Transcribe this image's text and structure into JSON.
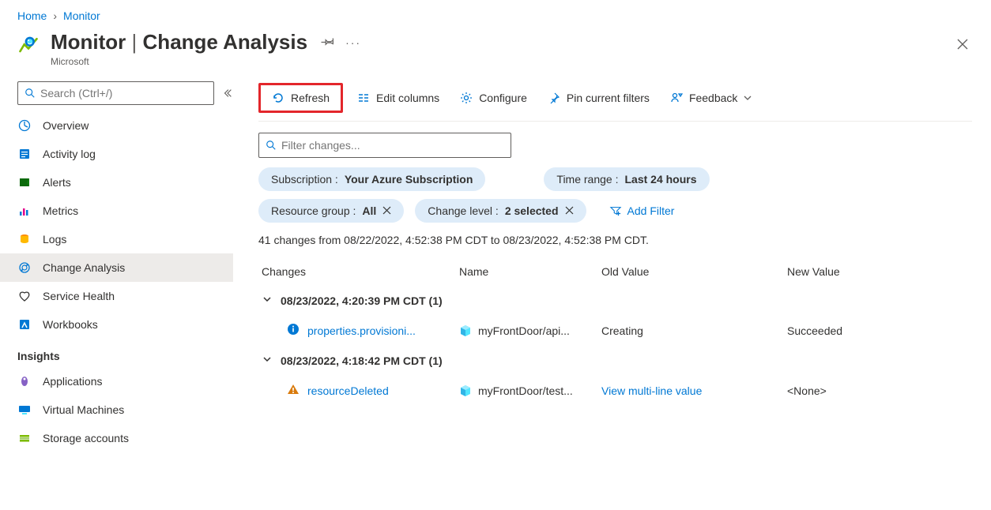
{
  "breadcrumb": {
    "home": "Home",
    "current": "Monitor"
  },
  "header": {
    "title_bold": "Monitor",
    "title_rest": "Change Analysis",
    "subtitle": "Microsoft"
  },
  "search": {
    "placeholder": "Search (Ctrl+/)"
  },
  "nav": {
    "items": [
      {
        "label": "Overview"
      },
      {
        "label": "Activity log"
      },
      {
        "label": "Alerts"
      },
      {
        "label": "Metrics"
      },
      {
        "label": "Logs"
      },
      {
        "label": "Change Analysis"
      },
      {
        "label": "Service Health"
      },
      {
        "label": "Workbooks"
      }
    ],
    "section": "Insights",
    "insights": [
      {
        "label": "Applications"
      },
      {
        "label": "Virtual Machines"
      },
      {
        "label": "Storage accounts"
      }
    ]
  },
  "toolbar": {
    "refresh": "Refresh",
    "edit_columns": "Edit columns",
    "configure": "Configure",
    "pin": "Pin current filters",
    "feedback": "Feedback"
  },
  "filter_input": {
    "placeholder": "Filter changes..."
  },
  "pills": {
    "subscription_label": "Subscription :",
    "subscription_value": "Your Azure Subscription",
    "time_label": "Time range :",
    "time_value": "Last 24 hours",
    "rg_label": "Resource group :",
    "rg_value": "All",
    "level_label": "Change level :",
    "level_value": "2 selected",
    "add_filter": "Add Filter"
  },
  "summary": "41 changes from 08/22/2022, 4:52:38 PM CDT to 08/23/2022, 4:52:38 PM CDT.",
  "columns": {
    "c1": "Changes",
    "c2": "Name",
    "c3": "Old Value",
    "c4": "New Value"
  },
  "groups": [
    {
      "title": "08/23/2022, 4:20:39 PM CDT (1)",
      "rows": [
        {
          "change": "properties.provisioni...",
          "name": "myFrontDoor/api...",
          "old": "Creating",
          "new": "Succeeded",
          "icon": "info"
        }
      ]
    },
    {
      "title": "08/23/2022, 4:18:42 PM CDT (1)",
      "rows": [
        {
          "change": "resourceDeleted",
          "name": "myFrontDoor/test...",
          "old": "View multi-line value",
          "old_link": true,
          "new": "<None>",
          "icon": "warn"
        }
      ]
    }
  ]
}
